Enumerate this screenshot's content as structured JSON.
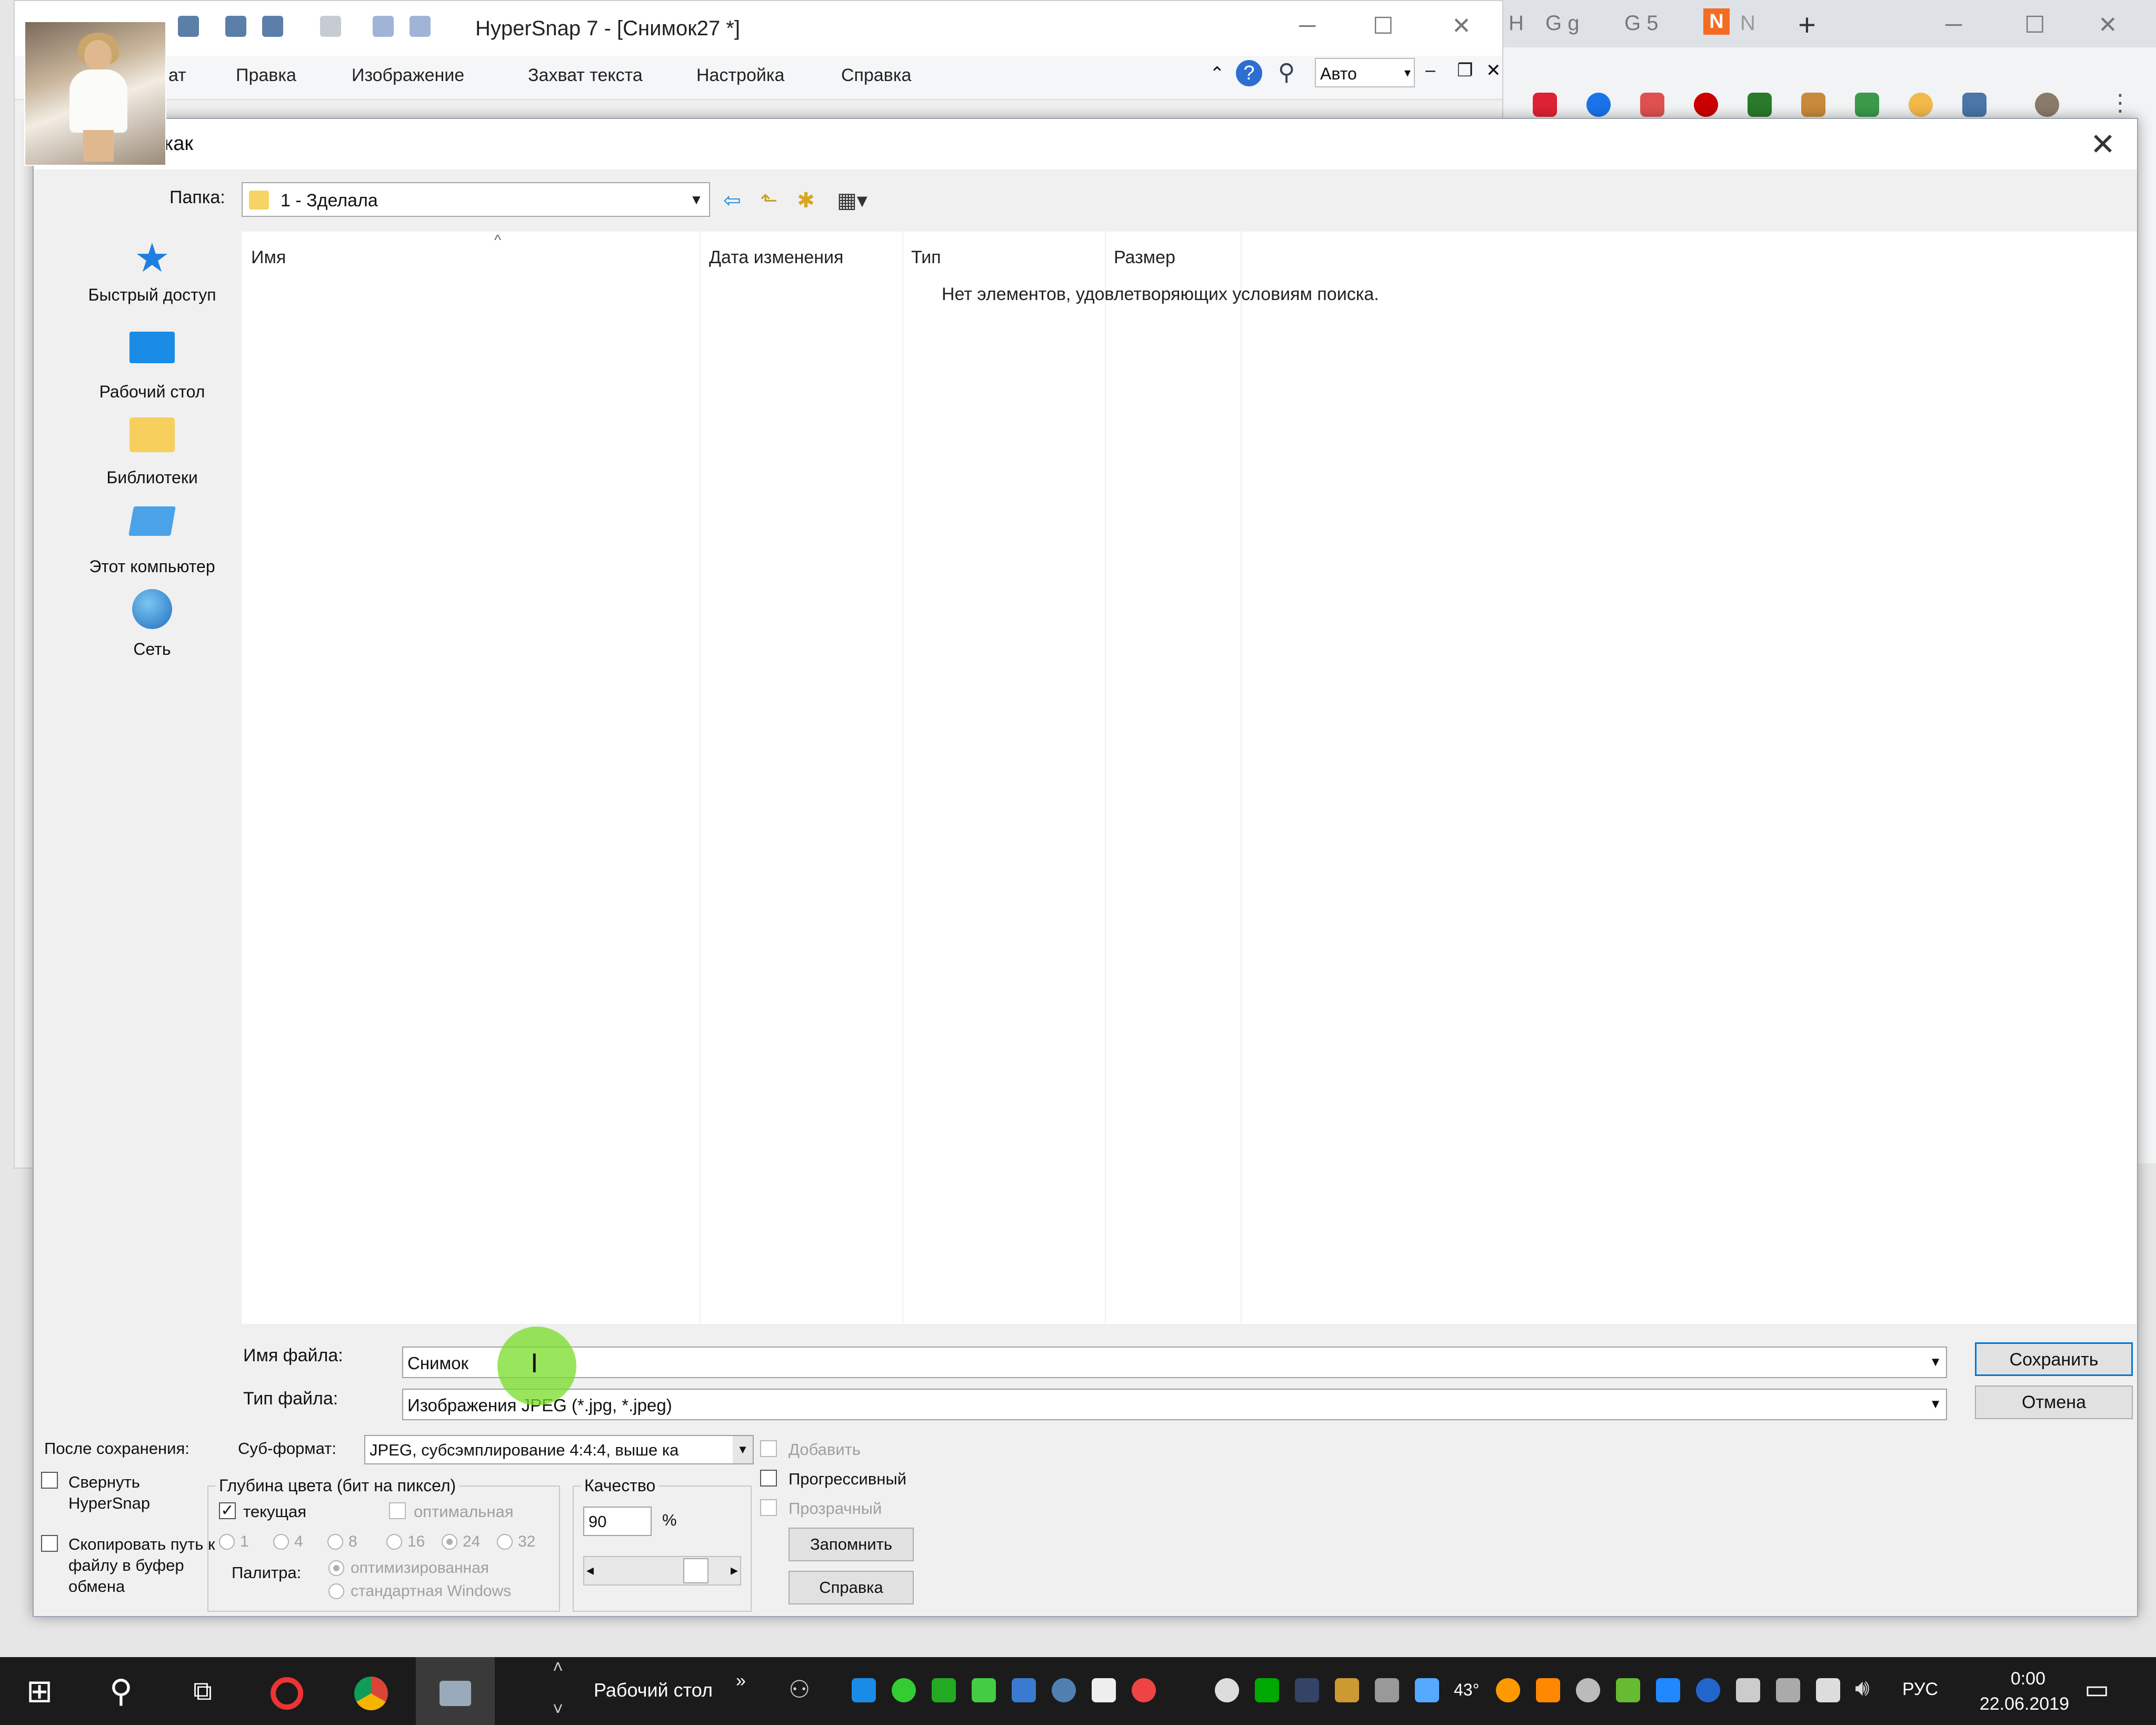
{
  "hypersnap": {
    "title": "HyperSnap 7 - [Снимок27 *]",
    "menu": [
      "ат",
      "Правка",
      "Изображение",
      "Захват текста",
      "Настройка",
      "Справка"
    ],
    "zoom_value": "Авто"
  },
  "chrome": {
    "tabs": [
      "H",
      "G g",
      "G 5",
      "N",
      "N"
    ],
    "new_tab": "+"
  },
  "dialog": {
    "title": "ть как",
    "close": "✕",
    "folder_label": "Папка:",
    "folder_value": "1 - Зделала",
    "places": [
      {
        "label": "Быстрый доступ",
        "icon": "star-icon"
      },
      {
        "label": "Рабочий стол",
        "icon": "desktop-icon"
      },
      {
        "label": "Библиотеки",
        "icon": "libraries-icon"
      },
      {
        "label": "Этот компьютер",
        "icon": "computer-icon"
      },
      {
        "label": "Сеть",
        "icon": "network-icon"
      }
    ],
    "columns": [
      "Имя",
      "Дата изменения",
      "Тип",
      "Размер"
    ],
    "empty_message": "Нет элементов, удовлетворяющих условиям поиска.",
    "filename_label": "Имя файла:",
    "filename_value": "Снимок",
    "filetype_label": "Тип файла:",
    "filetype_value": "Изображения JPEG (*.jpg, *.jpeg)",
    "save_button": "Сохранить",
    "cancel_button": "Отмена",
    "after_save_label": "После сохранения:",
    "minimize_label": "Свернуть HyperSnap",
    "copy_path_label": "Скопировать путь к файлу в буфер обмена",
    "subformat_label": "Суб-формат:",
    "subformat_value": "JPEG, субсэмплирование 4:4:4, выше ка",
    "depth_group": "Глубина цвета (бит на пиксел)",
    "depth_current": "текущая",
    "depth_optimal": "оптимальная",
    "depth_options": [
      "1",
      "4",
      "8",
      "16",
      "24",
      "32"
    ],
    "palette_label": "Палитра:",
    "palette_optimized": "оптимизированная",
    "palette_windows": "стандартная Windows",
    "quality_group": "Качество",
    "quality_value": "90",
    "quality_unit": "%",
    "add_label": "Добавить",
    "progressive_label": "Прогрессивный",
    "transparent_label": "Прозрачный",
    "remember_button": "Запомнить",
    "help_button": "Справка"
  },
  "taskbar": {
    "desktop_label": "Рабочий стол",
    "chevron": "»",
    "temperature": "43°",
    "language": "РУС",
    "time": "0:00",
    "date": "22.06.2019"
  },
  "colors": {
    "accent": "#0078d7",
    "taskbar": "#1b1b1b",
    "cursor_highlight": "#78dc28"
  }
}
